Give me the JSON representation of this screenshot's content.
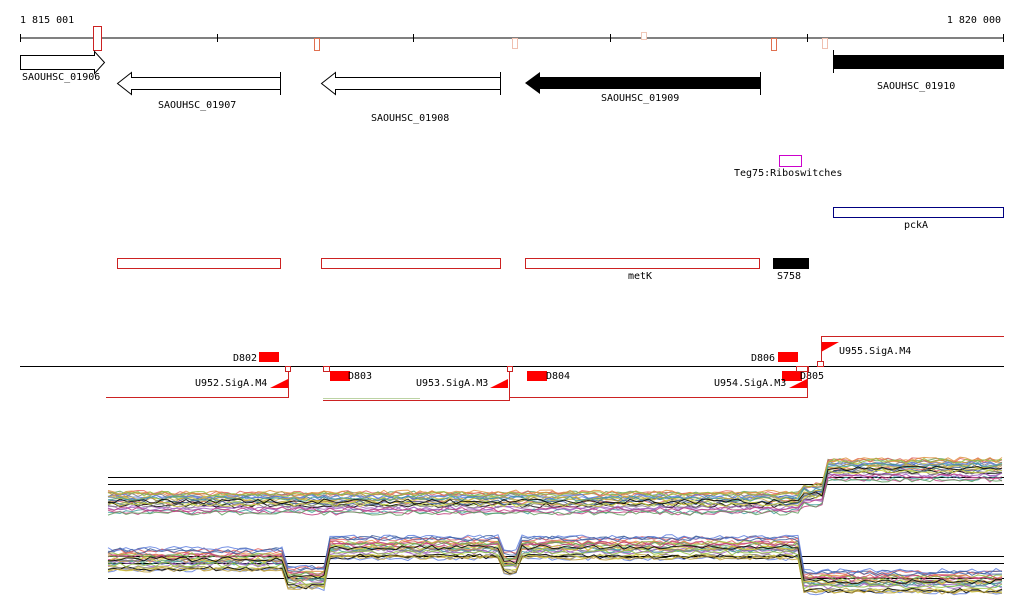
{
  "ruler": {
    "start_label": "1 815 001",
    "end_label": "1 820 000"
  },
  "colors": {
    "red": "#ff0000",
    "dark_red": "#cc2222",
    "magenta": "#cc00cc",
    "navy": "#000080",
    "black": "#000000"
  },
  "genes": [
    {
      "label": "SAOUHSC_01906",
      "strand": "+",
      "style": "open"
    },
    {
      "label": "SAOUHSC_01907",
      "strand": "-",
      "style": "open"
    },
    {
      "label": "SAOUHSC_01908",
      "strand": "-",
      "style": "open"
    },
    {
      "label": "SAOUHSC_01909",
      "strand": "-",
      "style": "filled"
    },
    {
      "label": "SAOUHSC_01910",
      "strand": "+",
      "style": "filled"
    }
  ],
  "riboswitch": {
    "label": "Teg75:Riboswitches"
  },
  "gene_names": {
    "pcka": "pckA",
    "metk": "metK",
    "s758": "S758"
  },
  "features": {
    "d802": "D802",
    "d803": "D803",
    "d804": "D804",
    "d805": "D805",
    "d806": "D806",
    "u952": "U952.SigA.M4",
    "u953": "U953.SigA.M3",
    "u954": "U954.SigA.M3",
    "u955": "U955.SigA.M4"
  }
}
